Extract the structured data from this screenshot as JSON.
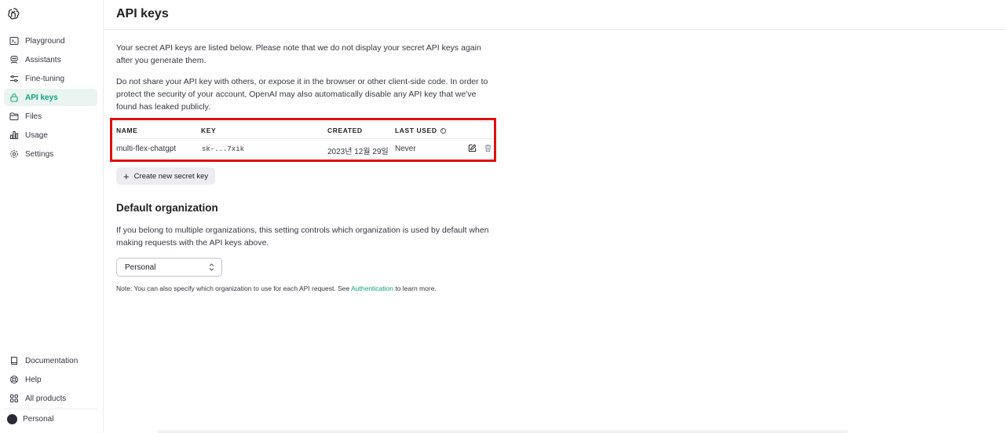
{
  "sidebar": {
    "items": [
      {
        "label": "Playground",
        "icon": "terminal-icon"
      },
      {
        "label": "Assistants",
        "icon": "assistant-icon"
      },
      {
        "label": "Fine-tuning",
        "icon": "sliders-icon"
      },
      {
        "label": "API keys",
        "icon": "lock-icon",
        "active": true
      },
      {
        "label": "Files",
        "icon": "folder-icon"
      },
      {
        "label": "Usage",
        "icon": "bar-chart-icon"
      },
      {
        "label": "Settings",
        "icon": "gear-icon"
      }
    ],
    "bottom_items": [
      {
        "label": "Documentation",
        "icon": "book-icon"
      },
      {
        "label": "Help",
        "icon": "lifebuoy-icon"
      },
      {
        "label": "All products",
        "icon": "grid-icon"
      }
    ],
    "org_label": "Personal"
  },
  "header": {
    "title": "API keys"
  },
  "intro": {
    "p1": "Your secret API keys are listed below. Please note that we do not display your secret API keys again after you generate them.",
    "p2": "Do not share your API key with others, or expose it in the browser or other client-side code. In order to protect the security of your account, OpenAI may also automatically disable any API key that we've found has leaked publicly."
  },
  "table": {
    "headers": {
      "name": "NAME",
      "key": "KEY",
      "created": "CREATED",
      "last_used": "LAST USED"
    },
    "rows": [
      {
        "name": "multi-flex-chatgpt",
        "key": "sk-...7xik",
        "created": "2023년 12월 29일",
        "last_used": "Never"
      }
    ]
  },
  "create_button": "Create new secret key",
  "default_org": {
    "title": "Default organization",
    "description": "If you belong to multiple organizations, this setting controls which organization is used by default when making requests with the API keys above.",
    "selected": "Personal"
  },
  "note": {
    "prefix": "Note: You can also specify which organization to use for each API request. See ",
    "link": "Authentication",
    "suffix": " to learn more."
  },
  "colors": {
    "accent": "#10a37f",
    "highlight_border": "#e01010",
    "active_bg": "#eaf4f0"
  }
}
